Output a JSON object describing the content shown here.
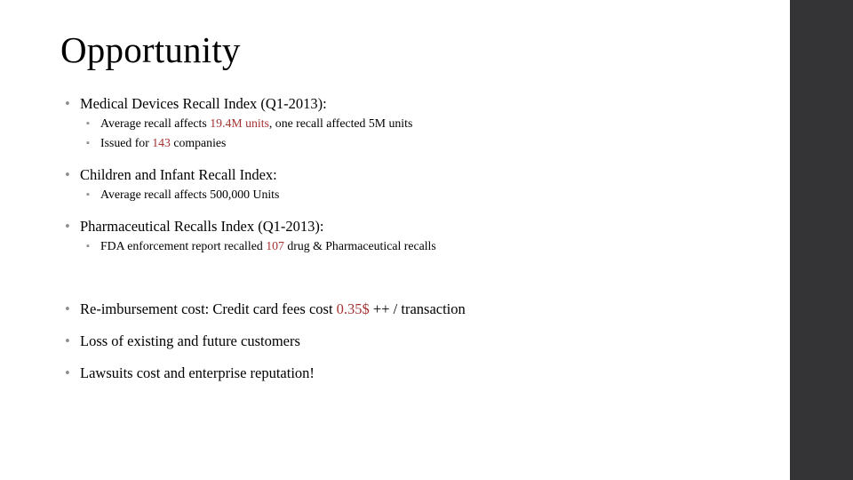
{
  "slide": {
    "title": "Opportunity",
    "accent_color": "#343437",
    "highlight_color": "#a63333",
    "text_color": "#000000",
    "background_color": "#ffffff",
    "bullet_marker_level1": "•",
    "bullet_marker_level2": "▪"
  },
  "groups": [
    {
      "heading": "Medical Devices Recall Index (Q1-2013):",
      "subs": [
        {
          "pre": "Average recall affects ",
          "highlight": "19.4M units",
          "post": ", one recall affected 5M units"
        },
        {
          "pre": "Issued for ",
          "highlight": "143",
          "post": " companies"
        }
      ]
    },
    {
      "heading": "Children and Infant Recall Index:",
      "subs": [
        {
          "pre": "Average recall affects 500,000 Units",
          "highlight": "",
          "post": ""
        }
      ]
    },
    {
      "heading": "Pharmaceutical Recalls Index (Q1-2013):",
      "subs": [
        {
          "pre": "FDA enforcement report recalled ",
          "highlight": "107",
          "post": " drug & Pharmaceutical recalls"
        }
      ]
    }
  ],
  "tail_bullets": [
    {
      "pre": "Re-imbursement cost: Credit card fees cost ",
      "highlight": "0.35$",
      "post": " ++ / transaction"
    },
    {
      "pre": "Loss of existing and future customers",
      "highlight": "",
      "post": ""
    },
    {
      "pre": "Lawsuits cost and enterprise reputation!",
      "highlight": "",
      "post": ""
    }
  ]
}
